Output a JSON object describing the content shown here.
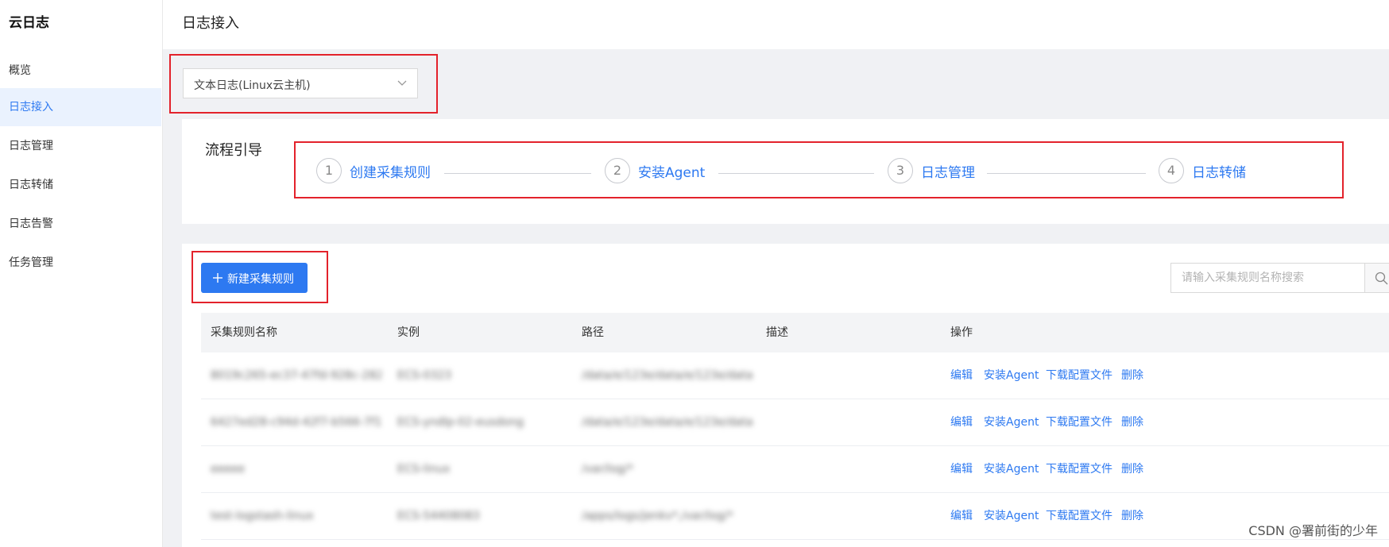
{
  "sidebar": {
    "title": "云日志",
    "items": [
      {
        "label": "概览"
      },
      {
        "label": "日志接入",
        "active": true
      },
      {
        "label": "日志管理"
      },
      {
        "label": "日志转储"
      },
      {
        "label": "日志告警"
      },
      {
        "label": "任务管理"
      }
    ]
  },
  "header": {
    "title": "日志接入"
  },
  "source_select": {
    "value": "文本日志(Linux云主机)",
    "icon": "chevron-down-icon"
  },
  "guide": {
    "label": "流程引导",
    "steps": [
      {
        "num": "1",
        "label": "创建采集规则"
      },
      {
        "num": "2",
        "label": "安装Agent"
      },
      {
        "num": "3",
        "label": "日志管理"
      },
      {
        "num": "4",
        "label": "日志转储"
      }
    ]
  },
  "toolbar": {
    "new_rule_label": "新建采集规则",
    "search_placeholder": "请输入采集规则名称搜索"
  },
  "table": {
    "columns": [
      "采集规则名称",
      "实例",
      "路径",
      "描述",
      "操作"
    ],
    "rows": [
      {
        "name": "8019c265-ec37-47fd-928c-282...",
        "instance": "ECS-0323",
        "path": "/data/e/123e/data/e/123e/data/...",
        "desc": ""
      },
      {
        "name": "6427ed28-c94d-42f7-b566-7f1...",
        "instance": "ECS-yndlp-02-eusdong",
        "path": "/data/e/123e/data/e/123e/data/...",
        "desc": ""
      },
      {
        "name": "eeeee",
        "instance": "ECS-linux",
        "path": "/var/log/*",
        "desc": ""
      },
      {
        "name": "test-logstash-linux",
        "instance": "ECS-54408083",
        "path": "/apps/logs/jenkv*,/var/log/*",
        "desc": ""
      }
    ],
    "actions": [
      "编辑",
      "安装Agent",
      "下载配置文件",
      "删除"
    ]
  },
  "watermark": "CSDN @署前街的少年",
  "colors": {
    "accent": "#2d79f1",
    "annotation_red": "#e3222b",
    "active_bg": "#eaf2fe"
  }
}
